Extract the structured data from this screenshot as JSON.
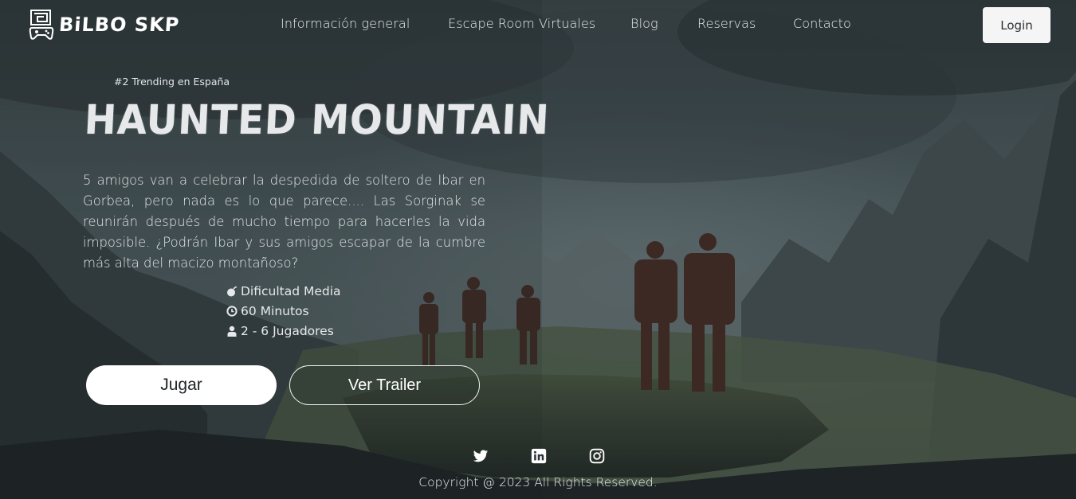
{
  "brand": {
    "name": "BiLBO SKP",
    "logo_icon": "gamepad-maze-icon"
  },
  "nav": {
    "links": [
      "Información general",
      "Escape Room Virtuales",
      "Blog",
      "Reservas",
      "Contacto"
    ],
    "login_label": "Login"
  },
  "hero": {
    "badge": "#2 Trending en España",
    "title": "HAUNTED MOUNTAIN",
    "description": "5 amigos van a celebrar la despedida de soltero de Ibar en Gorbea, pero nada es lo que parece.... Las Sorginak se reunirán después de mucho tiempo para hacerles la vida imposible. ¿Podrán Ibar y sus amigos escapar de la cumbre más alta del macizo montañoso?",
    "features": [
      {
        "icon": "bomb-icon",
        "text": "Dificultad Media"
      },
      {
        "icon": "clock-icon",
        "text": "60 Minutos"
      },
      {
        "icon": "user-icon",
        "text": "2 - 6 Jugadores"
      }
    ],
    "play_label": "Jugar",
    "trailer_label": "Ver Trailer"
  },
  "footer": {
    "social": [
      "twitter-icon",
      "linkedin-icon",
      "instagram-icon"
    ],
    "copyright": "Copyright @ 2023 All Rights Reserved."
  },
  "colors": {
    "sky_dark": "#2f3a3d",
    "mountain": "#3c484b",
    "button_light": "#f5f5f5"
  }
}
